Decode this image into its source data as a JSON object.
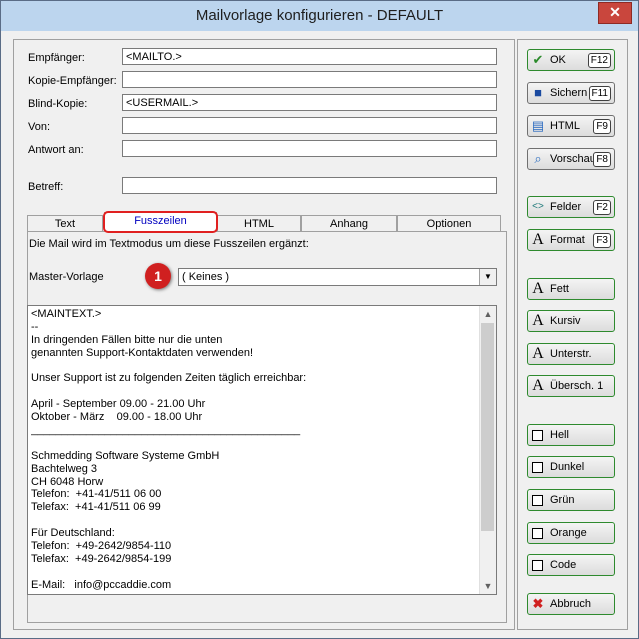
{
  "window": {
    "title": "Mailvorlage konfigurieren - DEFAULT",
    "close": "✕"
  },
  "fields": [
    {
      "label": "Empfänger:",
      "value": "<MAILTO.>"
    },
    {
      "label": "Kopie-Empfänger:",
      "value": ""
    },
    {
      "label": "Blind-Kopie:",
      "value": "<USERMAIL.>"
    },
    {
      "label": "Von:",
      "value": ""
    },
    {
      "label": "Antwort an:",
      "value": ""
    },
    {
      "label": "Betreff:",
      "value": ""
    }
  ],
  "tabs": [
    "Text",
    "Fusszeilen",
    "HTML",
    "Anhang",
    "Optionen"
  ],
  "active_tab": "Fusszeilen",
  "tab_page": {
    "hint": "Die Mail wird im Textmodus um diese Fusszeilen ergänzt:",
    "master_label": "Master-Vorlage",
    "master_value": "( Keines )",
    "badge": "1"
  },
  "memo_lines": [
    "<MAINTEXT.>",
    "--",
    "In dringenden Fällen bitte nur die unten",
    "genannten Support-Kontaktdaten verwenden!",
    "",
    "Unser Support ist zu folgenden Zeiten täglich erreichbar:",
    "",
    "April - September 09.00 - 21.00 Uhr",
    "Oktober - März    09.00 - 18.00 Uhr",
    "____________________________________________",
    "",
    "Schmedding Software Systeme GmbH",
    "Bachtelweg 3",
    "CH 6048 Horw",
    "Telefon:  +41-41/511 06 00",
    "Telefax:  +41-41/511 06 99",
    "",
    "Für Deutschland:",
    "Telefon:  +49-2642/9854-110",
    "Telefax:  +49-2642/9854-199",
    "",
    "E-Mail:   info@pccaddie.com"
  ],
  "buttons": {
    "ok": {
      "label": "OK",
      "key": "F12",
      "icon": "check-icon"
    },
    "save": {
      "label": "Sichern",
      "key": "F11",
      "icon": "floppy-icon"
    },
    "html": {
      "label": "HTML",
      "key": "F9",
      "icon": "document-icon"
    },
    "preview": {
      "label": "Vorschau",
      "key": "F8",
      "icon": "magnifier-icon"
    },
    "fields": {
      "label": "Felder",
      "key": "F2",
      "icon": "code-brackets-icon"
    },
    "format": {
      "label": "Format",
      "key": "F3",
      "icon": "font-a-icon"
    },
    "bold": {
      "label": "Fett",
      "icon": "font-a-icon"
    },
    "italic": {
      "label": "Kursiv",
      "icon": "font-a-icon"
    },
    "underline": {
      "label": "Unterstr.",
      "icon": "font-a-icon"
    },
    "heading": {
      "label": "Übersch. 1",
      "icon": "font-a-icon"
    },
    "light": {
      "label": "Hell"
    },
    "dark": {
      "label": "Dunkel"
    },
    "green": {
      "label": "Grün"
    },
    "orange": {
      "label": "Orange"
    },
    "code": {
      "label": "Code"
    },
    "cancel": {
      "label": "Abbruch",
      "icon": "x-icon"
    }
  }
}
